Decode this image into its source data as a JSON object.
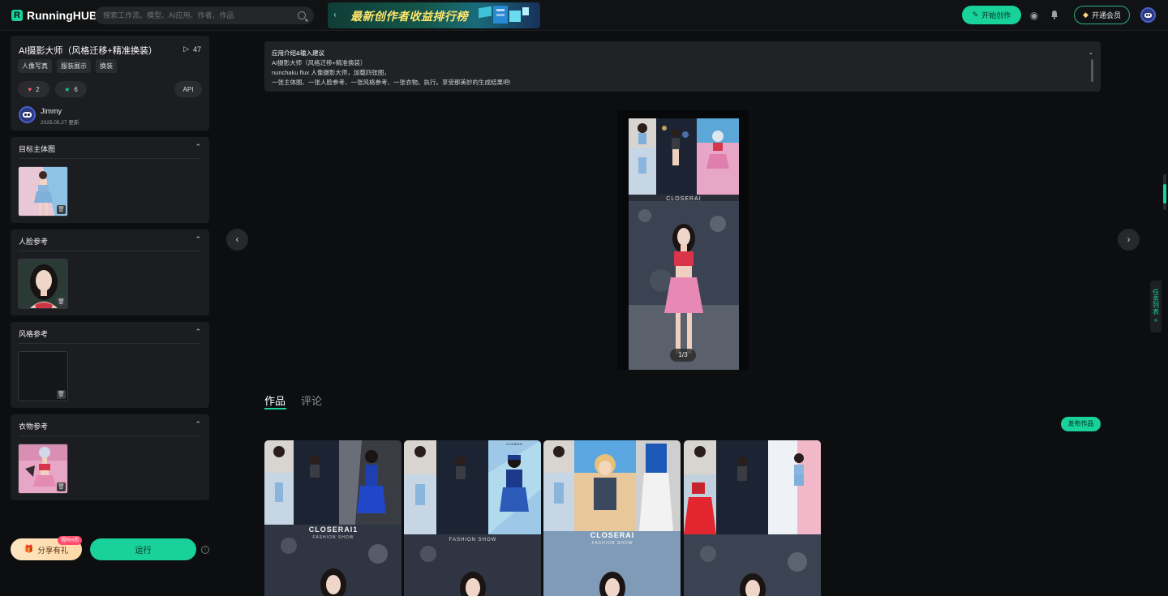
{
  "header": {
    "brand": "RunningHUB",
    "search_placeholder": "搜索工作流、模型、AI应用、作者、作品",
    "banner_text": "最新创作者收益排行榜",
    "create_label": "开始创作",
    "vip_label": "开通会员"
  },
  "app": {
    "title": "AI摄影大师（风格迁移+精准换装）",
    "run_count": "47",
    "tags": [
      "人像写真",
      "服装展示",
      "换装"
    ],
    "likes": "2",
    "favorites": "6",
    "api_label": "API",
    "author_name": "Jimmy",
    "author_date": "2025.05.27 更新"
  },
  "inputs": [
    {
      "label": "目标主体图"
    },
    {
      "label": "人脸参考"
    },
    {
      "label": "风格参考"
    },
    {
      "label": "衣物参考"
    }
  ],
  "actions": {
    "share_label": "分享有礼",
    "share_badge": "得RH币",
    "run_label": "运行"
  },
  "description": {
    "title": "应用介绍&输入建议",
    "line1": "AI摄影大师（风格迁移+精准换装）",
    "line2": "nunchaku flux 人像摄影大师，加载四张图，",
    "line3": "一张主体图、一张人脸参考、一张风格参考、一张衣物。执行。享受那美妙的生成结果吧!"
  },
  "gallery": {
    "counter": "1/3",
    "watermark": "CLOSERAI"
  },
  "tabs": {
    "works": "作品",
    "comments": "评论"
  },
  "publish_label": "发布作品",
  "works": [
    {
      "watermark": "CLOSERAI1",
      "sub": "FASHION SHOW"
    },
    {
      "watermark": "CLOSERAI",
      "sub": "FASHION SHOW"
    },
    {
      "watermark": "CLOSERAI",
      "sub": "FASHION SHOW"
    },
    {
      "watermark": "",
      "sub": ""
    }
  ],
  "side_panel_label": "任务列表",
  "colors": {
    "accent": "#18d19b",
    "background": "#0d0e10",
    "card": "#1c1d20"
  }
}
